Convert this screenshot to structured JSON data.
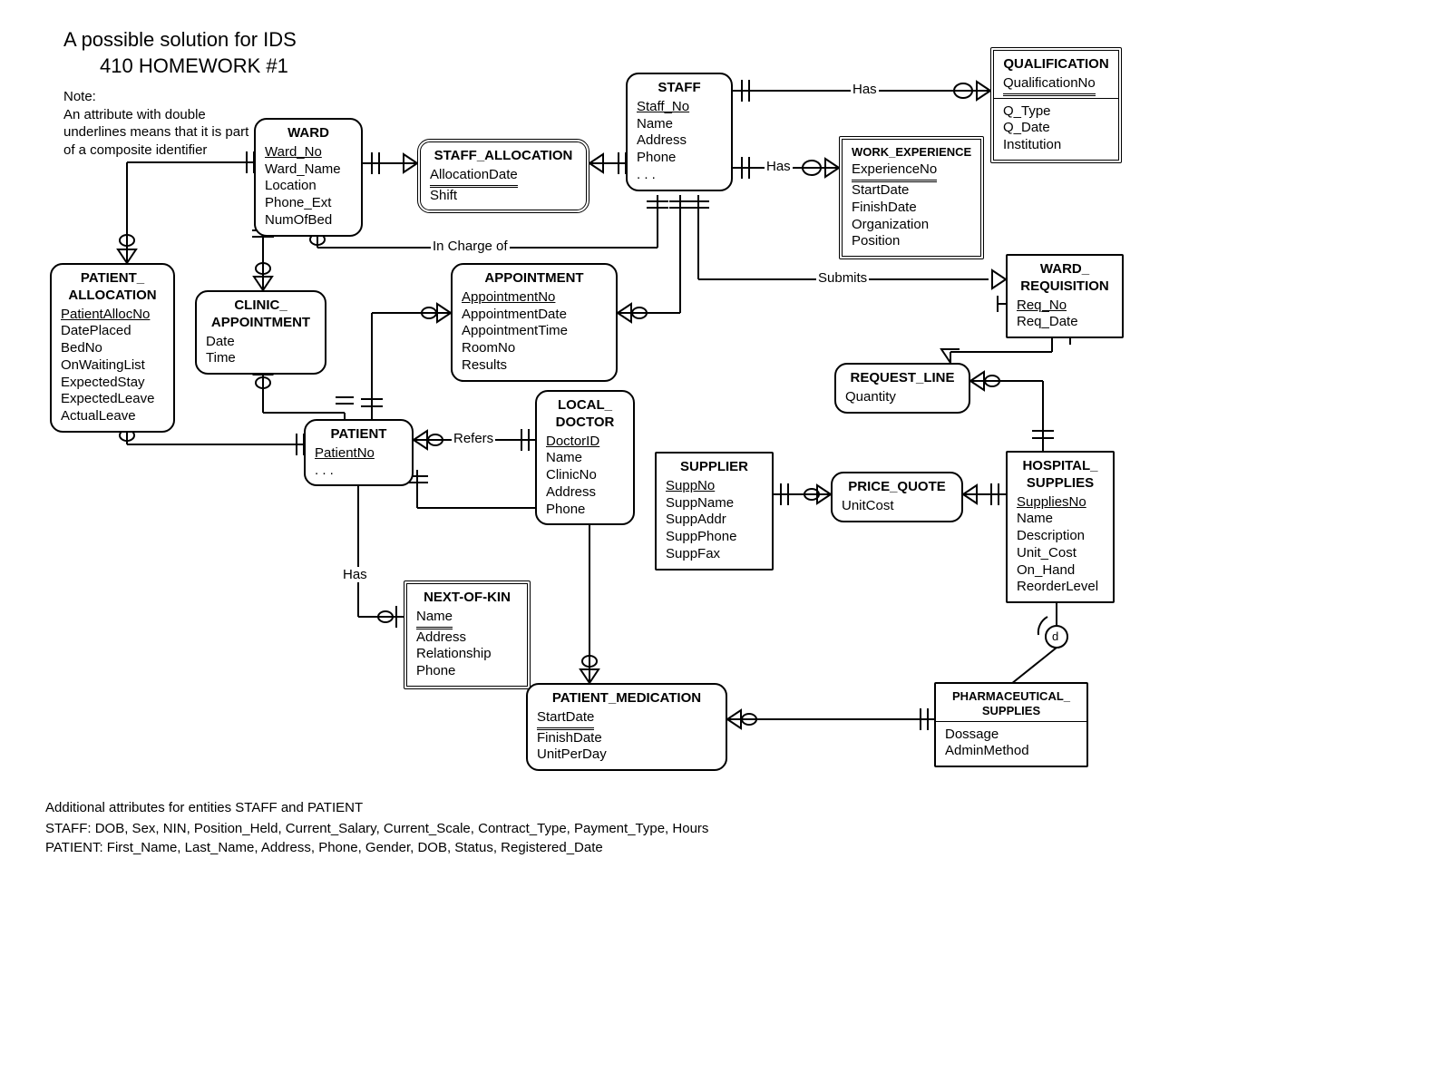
{
  "title": {
    "line1": "A possible solution for IDS",
    "line2": "410 HOMEWORK #1"
  },
  "note": {
    "heading": "Note:",
    "line1": "An attribute with double",
    "line2": "underlines  means that it is part",
    "line3": "of a composite identifier"
  },
  "footer": {
    "title": "Additional attributes for entities STAFF and PATIENT",
    "staff": "STAFF: DOB, Sex, NIN, Position_Held, Current_Salary, Current_Scale, Contract_Type, Payment_Type, Hours",
    "patient": "PATIENT: First_Name, Last_Name, Address, Phone, Gender, DOB, Status, Registered_Date"
  },
  "entities": {
    "ward": {
      "name": "WARD",
      "attrs": [
        "Ward_No",
        "Ward_Name",
        "Location",
        "Phone_Ext",
        "NumOfBed"
      ],
      "pk": [
        0
      ]
    },
    "staff_allocation": {
      "name": "STAFF_ALLOCATION",
      "attrs": [
        "AllocationDate",
        "Shift"
      ],
      "pk": [],
      "dpk": [
        0
      ]
    },
    "staff": {
      "name": "STAFF",
      "attrs": [
        "Staff_No",
        "Name",
        "Address",
        "Phone",
        ". . ."
      ],
      "pk": [
        0
      ]
    },
    "qualification": {
      "name": "QUALIFICATION",
      "attrs": [
        "QualificationNo",
        "Q_Type",
        "Q_Date",
        "Institution"
      ],
      "pk": [],
      "dpk": [
        0
      ]
    },
    "work_experience": {
      "name": "WORK_EXPERIENCE",
      "attrs": [
        "ExperienceNo",
        "StartDate",
        "FinishDate",
        "Organization",
        "Position"
      ],
      "pk": [],
      "dpk": [
        0
      ]
    },
    "patient_allocation": {
      "name": "PATIENT_\nALLOCATION",
      "attrs": [
        "PatientAllocNo",
        "DatePlaced",
        "BedNo",
        "OnWaitingList",
        "ExpectedStay",
        "ExpectedLeave",
        "ActualLeave"
      ],
      "pk": [
        0
      ]
    },
    "clinic_appointment": {
      "name": "CLINIC_\nAPPOINTMENT",
      "attrs": [
        "Date",
        "Time"
      ]
    },
    "appointment": {
      "name": "APPOINTMENT",
      "attrs": [
        "AppointmentNo",
        "AppointmentDate",
        "AppointmentTime",
        "RoomNo",
        "Results"
      ],
      "pk": [
        0
      ]
    },
    "patient": {
      "name": "PATIENT",
      "attrs": [
        "PatientNo",
        ". . ."
      ],
      "pk": [
        0
      ]
    },
    "local_doctor": {
      "name": "LOCAL_\nDOCTOR",
      "attrs": [
        "DoctorID",
        "Name",
        "ClinicNo",
        "Address",
        "Phone"
      ],
      "pk": [
        0
      ]
    },
    "supplier": {
      "name": "SUPPLIER",
      "attrs": [
        "SuppNo",
        "SuppName",
        "SuppAddr",
        "SuppPhone",
        "SuppFax"
      ],
      "pk": [
        0
      ]
    },
    "price_quote": {
      "name": "PRICE_QUOTE",
      "attrs": [
        "UnitCost"
      ]
    },
    "ward_requisition": {
      "name": "WARD_\nREQUISITION",
      "attrs": [
        "Req_No",
        "Req_Date"
      ],
      "pk": [
        0
      ]
    },
    "request_line": {
      "name": "REQUEST_LINE",
      "attrs": [
        "Quantity"
      ]
    },
    "hospital_supplies": {
      "name": "HOSPITAL_\nSUPPLIES",
      "attrs": [
        "SuppliesNo",
        "Name",
        "Description",
        "Unit_Cost",
        "On_Hand",
        "ReorderLevel"
      ],
      "pk": [
        0
      ]
    },
    "pharmaceutical_supplies": {
      "name": "PHARMACEUTICAL_\nSUPPLIES",
      "attrs": [
        "Dossage",
        "AdminMethod"
      ]
    },
    "next_of_kin": {
      "name": "NEXT-OF-KIN",
      "attrs": [
        "Name",
        "Address",
        "Relationship",
        "Phone"
      ],
      "dpk": [
        0
      ]
    },
    "patient_medication": {
      "name": "PATIENT_MEDICATION",
      "attrs": [
        "StartDate",
        "FinishDate",
        "UnitPerDay"
      ],
      "pk": [],
      "dpk": [
        0
      ]
    }
  },
  "relationships": {
    "has1": "Has",
    "has2": "Has",
    "has3": "Has",
    "submits": "Submits",
    "in_charge_of": "In Charge of",
    "refers": "Refers",
    "d": "d"
  }
}
